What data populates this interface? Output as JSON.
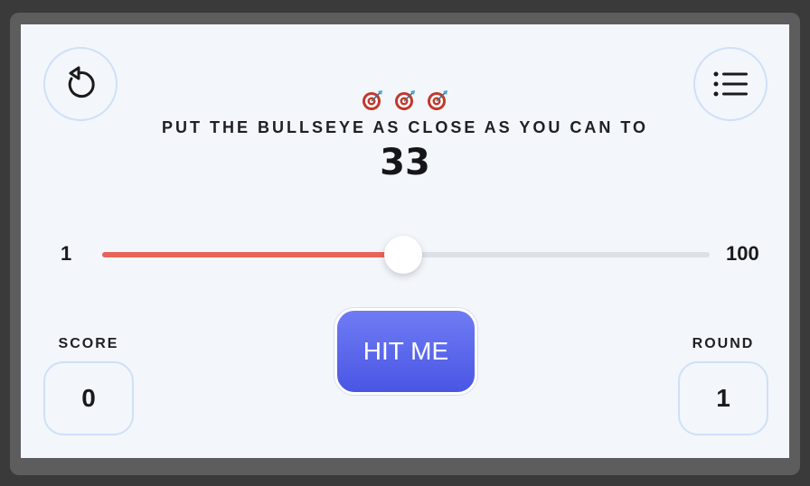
{
  "header": {
    "target_icons": [
      "dart-target-icon",
      "dart-target-icon",
      "dart-target-icon"
    ],
    "instruction": "PUT THE BULLSEYE AS CLOSE AS YOU CAN TO",
    "target_value": "33"
  },
  "slider": {
    "min_label": "1",
    "max_label": "100",
    "min": 1,
    "max": 100,
    "value": 50
  },
  "hit_button": {
    "label": "HIT ME"
  },
  "score": {
    "label": "SCORE",
    "value": "0"
  },
  "round": {
    "label": "ROUND",
    "value": "1"
  },
  "icons": {
    "restart": "restart-icon",
    "menu": "list-menu-icon"
  },
  "colors": {
    "accent": "#e8645a",
    "button": "#5563ea",
    "border": "#cfe0f8",
    "background": "#f3f6fb"
  }
}
